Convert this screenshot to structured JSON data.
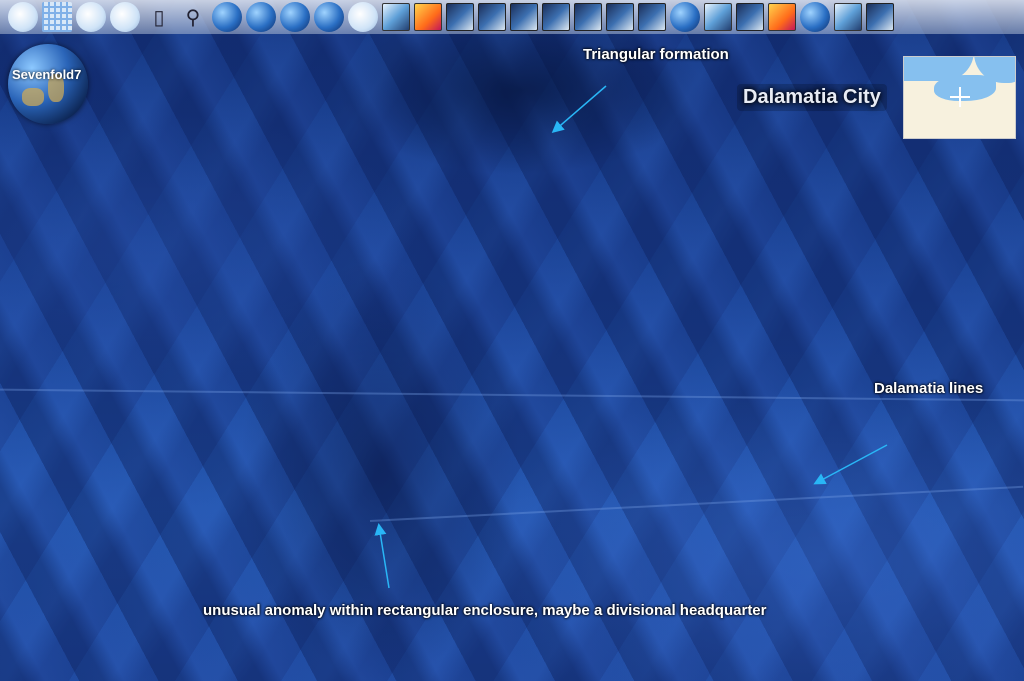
{
  "window": {
    "label": "Sevenfold7"
  },
  "map": {
    "place_label": "Dalamatia City"
  },
  "annotations": {
    "triangular": "Triangular formation",
    "lines": "Dalamatia lines",
    "anomaly": "unusual anomaly within rectangular enclosure, maybe a divisional headquarter"
  },
  "toolbar": {
    "items": [
      {
        "icon": "layers-icon"
      },
      {
        "icon": "grid-icon"
      },
      {
        "icon": "globe-icon"
      },
      {
        "icon": "compass-icon"
      },
      {
        "icon": "placemark-icon"
      },
      {
        "icon": "search-icon"
      },
      {
        "icon": "earth-icon"
      },
      {
        "icon": "earth-icon"
      },
      {
        "icon": "earth-icon"
      },
      {
        "icon": "satellite-icon"
      },
      {
        "icon": "weather-icon"
      },
      {
        "icon": "wms-layer-icon"
      },
      {
        "icon": "layer-icon"
      },
      {
        "icon": "layer-icon"
      },
      {
        "icon": "layer-icon"
      },
      {
        "icon": "layer-icon"
      },
      {
        "icon": "layer-icon"
      },
      {
        "icon": "layer-icon"
      },
      {
        "icon": "layer-icon"
      },
      {
        "icon": "layer-icon"
      },
      {
        "icon": "globe-icon"
      },
      {
        "icon": "map-layer-icon"
      },
      {
        "icon": "layer-icon"
      },
      {
        "icon": "flags-icon"
      },
      {
        "icon": "bluemarble-icon"
      },
      {
        "icon": "usa-map-icon"
      },
      {
        "icon": "settings-icon"
      }
    ]
  },
  "colors": {
    "annotation_arrow": "#29b6f6",
    "ocean": "#1c469a"
  }
}
